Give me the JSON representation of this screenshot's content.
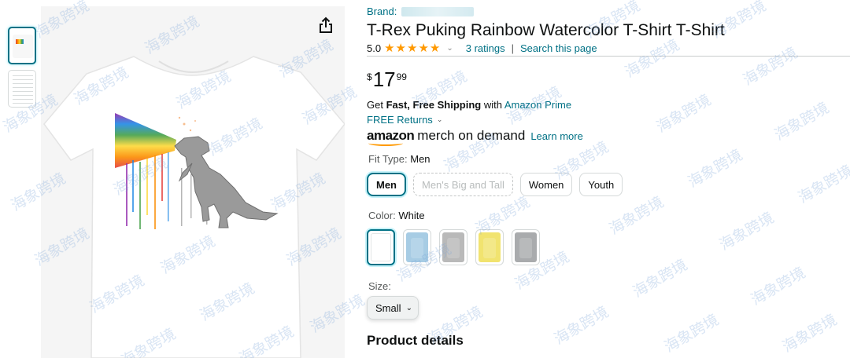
{
  "gallery": {
    "thumbnail_count": 2,
    "share_icon": "share-icon"
  },
  "product": {
    "brand_label": "Brand:",
    "title": "T-Rex Puking Rainbow Watercolor T-Shirt T-Shirt",
    "rating_value": "5.0",
    "rating_stars": 5,
    "ratings_link": "3 ratings",
    "separator": "|",
    "search_link": "Search this page",
    "price": {
      "symbol": "$",
      "whole": "17",
      "fraction": "99"
    }
  },
  "shipping": {
    "prefix": "Get ",
    "bold": "Fast, Free Shipping",
    "middle": " with ",
    "prime_link": "Amazon Prime",
    "returns": "FREE Returns"
  },
  "merch": {
    "logo_amazon": "amazon",
    "logo_rest": "merch on demand",
    "learn_more": "Learn more"
  },
  "fit_type": {
    "label": "Fit Type:",
    "selected": "Men",
    "options": [
      "Men",
      "Men's Big and Tall",
      "Women",
      "Youth"
    ]
  },
  "color": {
    "label": "Color:",
    "selected": "White",
    "swatches": [
      "#ffffff",
      "#a7cce4",
      "#b9b9b9",
      "#f1e36f",
      "#a9abad"
    ]
  },
  "size": {
    "label": "Size:",
    "selected": "Small"
  },
  "sections": {
    "product_details": "Product details"
  },
  "watermark": "海象跨境"
}
